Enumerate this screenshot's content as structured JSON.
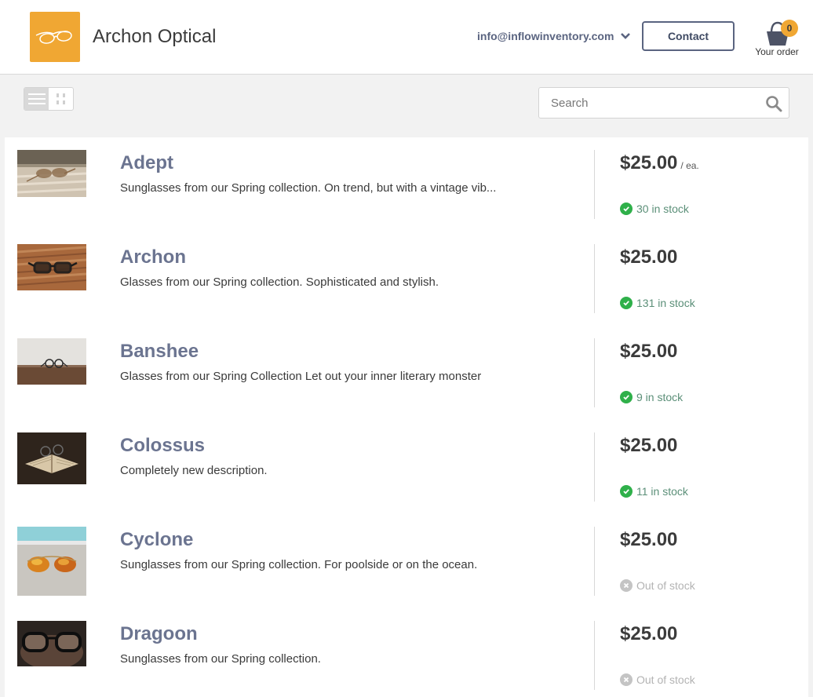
{
  "header": {
    "brand": "Archon Optical",
    "account_email": "info@inflowinventory.com",
    "contact_label": "Contact",
    "cart_label": "Your order",
    "cart_count": "0"
  },
  "toolbar": {
    "view_modes": [
      "list-view-icon",
      "grid-view-icon"
    ],
    "active_view": "list",
    "search_placeholder": "Search"
  },
  "products": [
    {
      "name": "Adept",
      "description": "Sunglasses from our Spring collection. On trend, but with a vintage vib...",
      "price": "$25.00",
      "unit": "/ ea.",
      "stock": "30 in stock",
      "in_stock": true,
      "image": "sunglasses-on-table-photo"
    },
    {
      "name": "Archon",
      "description": "Glasses from our Spring collection. Sophisticated and stylish.",
      "price": "$25.00",
      "unit": "",
      "stock": "131 in stock",
      "in_stock": true,
      "image": "glasses-on-wood-photo"
    },
    {
      "name": "Banshee",
      "description": "Glasses from our Spring Collection Let out your inner literary monster",
      "price": "$25.00",
      "unit": "",
      "stock": "9 in stock",
      "in_stock": true,
      "image": "round-glasses-on-desk-photo"
    },
    {
      "name": "Colossus",
      "description": "Completely new description.",
      "price": "$25.00",
      "unit": "",
      "stock": "11 in stock",
      "in_stock": true,
      "image": "glasses-on-book-photo"
    },
    {
      "name": "Cyclone",
      "description": "Sunglasses from our Spring collection. For poolside or on the ocean.",
      "price": "$25.00",
      "unit": "",
      "stock": "Out of stock",
      "in_stock": false,
      "image": "aviator-sunglasses-photo"
    },
    {
      "name": "Dragoon",
      "description": "Sunglasses from our Spring collection.",
      "price": "$25.00",
      "unit": "",
      "stock": "Out of stock",
      "in_stock": false,
      "image": "black-glasses-closeup-photo"
    }
  ],
  "colors": {
    "accent": "#f0a733",
    "product_name": "#6b7490",
    "in_stock": "#2fb04a",
    "out_of_stock": "#c4c4c4"
  }
}
